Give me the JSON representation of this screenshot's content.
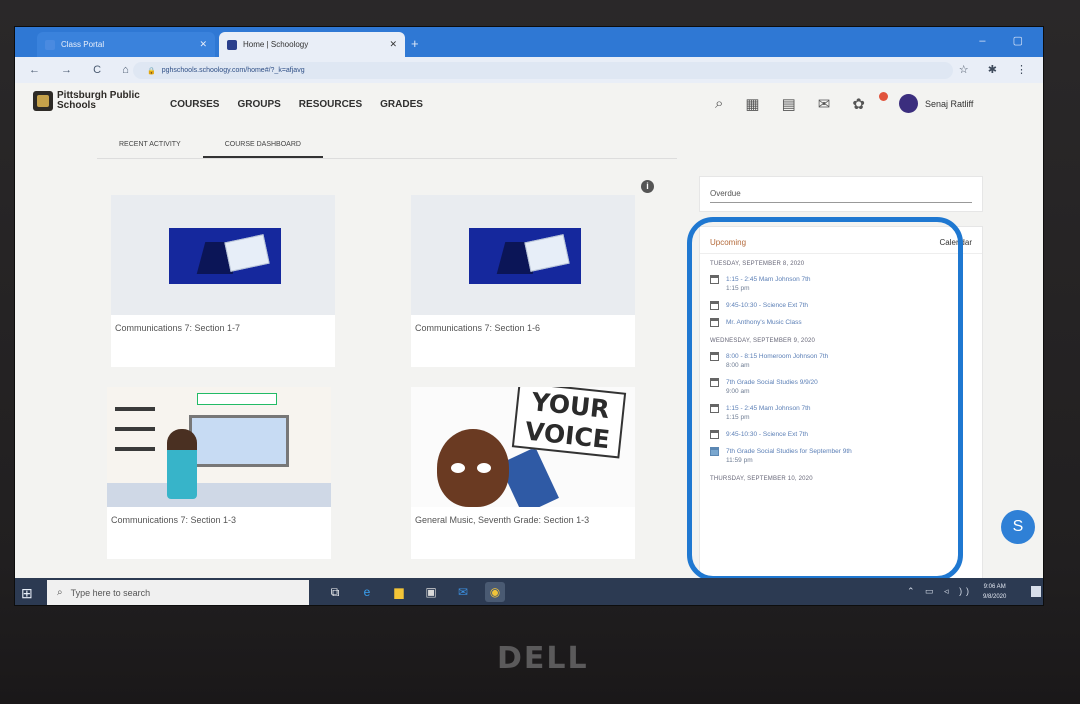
{
  "browser": {
    "tabs": [
      {
        "label": "Class Portal",
        "favicon_color": "#4a8ae0"
      },
      {
        "label": "Home | Schoology",
        "favicon_color": "#2b3f8c"
      }
    ],
    "url": "pghschools.schoology.com/home#/?_k=afjavg",
    "nav_glyphs": "← → C ⌂"
  },
  "app": {
    "logo_text": "Pittsburgh Public Schools",
    "nav": [
      "COURSES",
      "GROUPS",
      "RESOURCES",
      "GRADES"
    ],
    "user_name": "Senaj Ratliff",
    "subtabs": [
      {
        "label": "RECENT ACTIVITY",
        "active": false
      },
      {
        "label": "COURSE DASHBOARD",
        "active": true
      }
    ]
  },
  "courses": [
    {
      "title": "Communications 7: Section 1-7",
      "thumb": "blue"
    },
    {
      "title": "Communications 7: Section 1-6",
      "thumb": "blue"
    },
    {
      "title": "Communications 7: Section 1-3",
      "thumb": "classroom"
    },
    {
      "title": "General Music, Seventh Grade: Section 1-3",
      "thumb": "voice",
      "sign_line1": "YOUR",
      "sign_line2": "VOICE"
    }
  ],
  "overdue": {
    "label": "Overdue"
  },
  "upcoming": {
    "label": "Upcoming",
    "calendar_link": "Calendar",
    "days": [
      {
        "label": "TUESDAY, SEPTEMBER 8, 2020",
        "events": [
          {
            "text": "1:15 - 2:45 Mam Johnson 7th",
            "time": "1:15 pm",
            "icon": "calendar"
          },
          {
            "text": "9:45-10:30 - Science Ext 7th",
            "time": "",
            "icon": "calendar"
          },
          {
            "text": "Mr. Anthony's Music Class",
            "time": "",
            "icon": "calendar"
          }
        ]
      },
      {
        "label": "WEDNESDAY, SEPTEMBER 9, 2020",
        "events": [
          {
            "text": "8:00 - 8:15 Homeroom Johnson 7th",
            "time": "8:00 am",
            "icon": "calendar"
          },
          {
            "text": "7th Grade Social Studies 9/9/20",
            "time": "9:00 am",
            "icon": "calendar"
          },
          {
            "text": "1:15 - 2:45 Mam Johnson 7th",
            "time": "1:15 pm",
            "icon": "calendar"
          },
          {
            "text": "9:45-10:30 - Science Ext 7th",
            "time": "",
            "icon": "calendar"
          },
          {
            "text": "7th Grade Social Studies for September 9th",
            "time": "11:59 pm",
            "icon": "file"
          }
        ]
      },
      {
        "label": "THURSDAY, SEPTEMBER 10, 2020",
        "events": []
      }
    ]
  },
  "fab_label": "S",
  "taskbar": {
    "search_placeholder": "Type here to search",
    "clock_time": "9:06 AM",
    "clock_date": "9/8/2020"
  },
  "device": {
    "brand": "DELL"
  },
  "colors": {
    "highlight": "#1f78d1",
    "chrome_blue": "#2f78d4",
    "upcoming_accent": "#b46a3a"
  }
}
